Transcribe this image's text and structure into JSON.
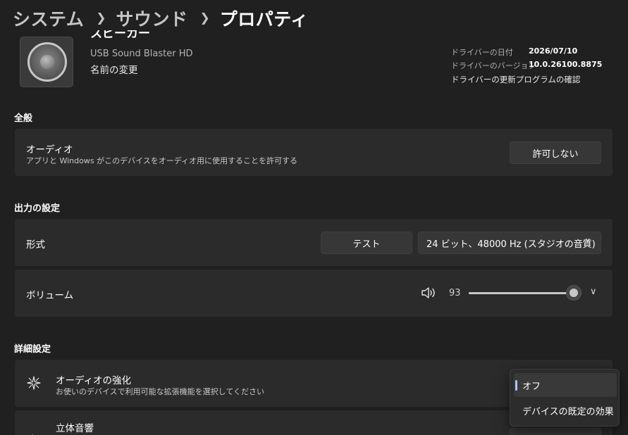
{
  "breadcrumb": {
    "items": [
      "システム",
      "サウンド",
      "プロパティ"
    ]
  },
  "device": {
    "name": "スピーカー",
    "subtitle": "USB Sound Blaster HD",
    "rename": "名前の変更"
  },
  "driver_info": {
    "rows": [
      {
        "label": "ドライバーの日付",
        "value": "2026/07/10"
      },
      {
        "label": "ドライバーのバージョン",
        "value": "10.0.26100.8875"
      }
    ],
    "update_link": "ドライバーの更新プログラムの確認"
  },
  "general": {
    "section_title": "全般",
    "audio_title": "オーディオ",
    "audio_desc": "アプリと Windows がこのデバイスをオーディオ用に使用することを許可する",
    "audio_button": "許可しない"
  },
  "output": {
    "section_title": "出力の設定",
    "format_label": "形式",
    "test_button": "テスト",
    "format_value": "24 ビット、48000 Hz (スタジオの音質)",
    "volume_label": "ボリューム",
    "volume_value": "93",
    "volume_fraction": 0.93
  },
  "advanced": {
    "section_title": "詳細設定",
    "enhance_title": "オーディオの強化",
    "enhance_desc": "お使いのデバイスで利用可能な拡張機能を選択してください",
    "spatial_title": "立体音響"
  },
  "dropdown": {
    "options": [
      "オフ",
      "デバイスの既定の効果"
    ],
    "selected_index": 0
  },
  "icons": {
    "chevron": "chevron-right-icon",
    "volume": "speaker-volume-icon",
    "enhance": "sparkle-icon",
    "spatial": "spatial-audio-icon"
  },
  "colors": {
    "background": "#202020",
    "card": "#2b2b2b",
    "accent": "#a8c7ff"
  }
}
